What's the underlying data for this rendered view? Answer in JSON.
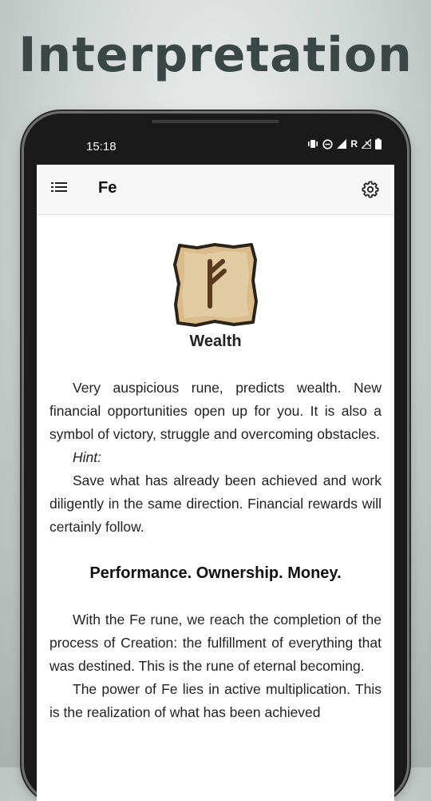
{
  "banner": {
    "title": "Interpretation"
  },
  "status_bar": {
    "time": "15:18",
    "icons": [
      "vibrate-icon",
      "dnd-icon",
      "signal-icon",
      "roaming-r-icon",
      "no-signal-icon",
      "battery-icon"
    ],
    "roaming_label": "R"
  },
  "app_bar": {
    "title": "Fe",
    "menu_icon": "menu-icon",
    "settings_icon": "gear-icon"
  },
  "rune": {
    "icon": "fehu-rune-tile",
    "name": "Wealth"
  },
  "paragraphs": {
    "intro": "Very auspicious rune, predicts wealth. New financial opportunities open up for you. It is also a symbol of victory, struggle and overcoming obstacles.",
    "hint_label": "Hint:",
    "hint_text": "Save what has already been achieved and work diligently in the same direction. Financial rewards will certainly follow.",
    "keywords": "Performance. Ownership. Money.",
    "body1": "With the Fe rune, we reach the completion of the process of Creation: the fulfillment of everything that was destined. This is the rune of eternal becoming.",
    "body2": "The power of Fe lies in active multiplication. This is the realization of what has been achieved"
  },
  "colors": {
    "banner_text": "#3b4646",
    "app_bar_bg": "#f7f7f7",
    "tile_wood": "#d9bb8c",
    "rune_stroke": "#5a3a1e"
  }
}
